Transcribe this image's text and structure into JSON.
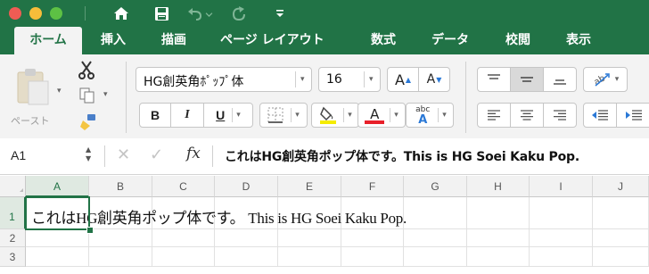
{
  "colors": {
    "accent": "#217346",
    "close": "#ee5c54",
    "minimize": "#f6bd3a",
    "zoom": "#5dc144",
    "font_color_bar": "#e8202a",
    "highlight_bar": "#f5ec00"
  },
  "titlebar": {
    "icons": [
      "close-button",
      "minimize-button",
      "zoom-button",
      "home-icon",
      "save-icon",
      "undo-icon",
      "redo-icon",
      "customize-toolbar-icon"
    ]
  },
  "tabs": [
    "ホーム",
    "挿入",
    "描画",
    "ページ レイアウト",
    "数式",
    "データ",
    "校閲",
    "表示"
  ],
  "ribbon": {
    "paste_label": "ペースト",
    "font_name": "HG創英角ﾎﾟｯﾌﾟ体",
    "font_size": "16",
    "increase_font": "A",
    "decrease_font": "A",
    "bold": "B",
    "italic": "I",
    "underline": "U",
    "font_color_letter": "A",
    "phonetic_top": "abc",
    "phonetic_bottom": "A"
  },
  "formula_bar": {
    "name_box": "A1",
    "fx": "fx",
    "content": "これはHG創英角ポップ体です。This is HG Soei Kaku Pop."
  },
  "sheet": {
    "columns": [
      "A",
      "B",
      "C",
      "D",
      "E",
      "F",
      "G",
      "H",
      "I",
      "J"
    ],
    "rows": [
      "1",
      "2",
      "3"
    ],
    "selected_cell": "A1",
    "cell_a1": "これはHG創英角ポップ体です。 This is HG Soei Kaku Pop."
  }
}
